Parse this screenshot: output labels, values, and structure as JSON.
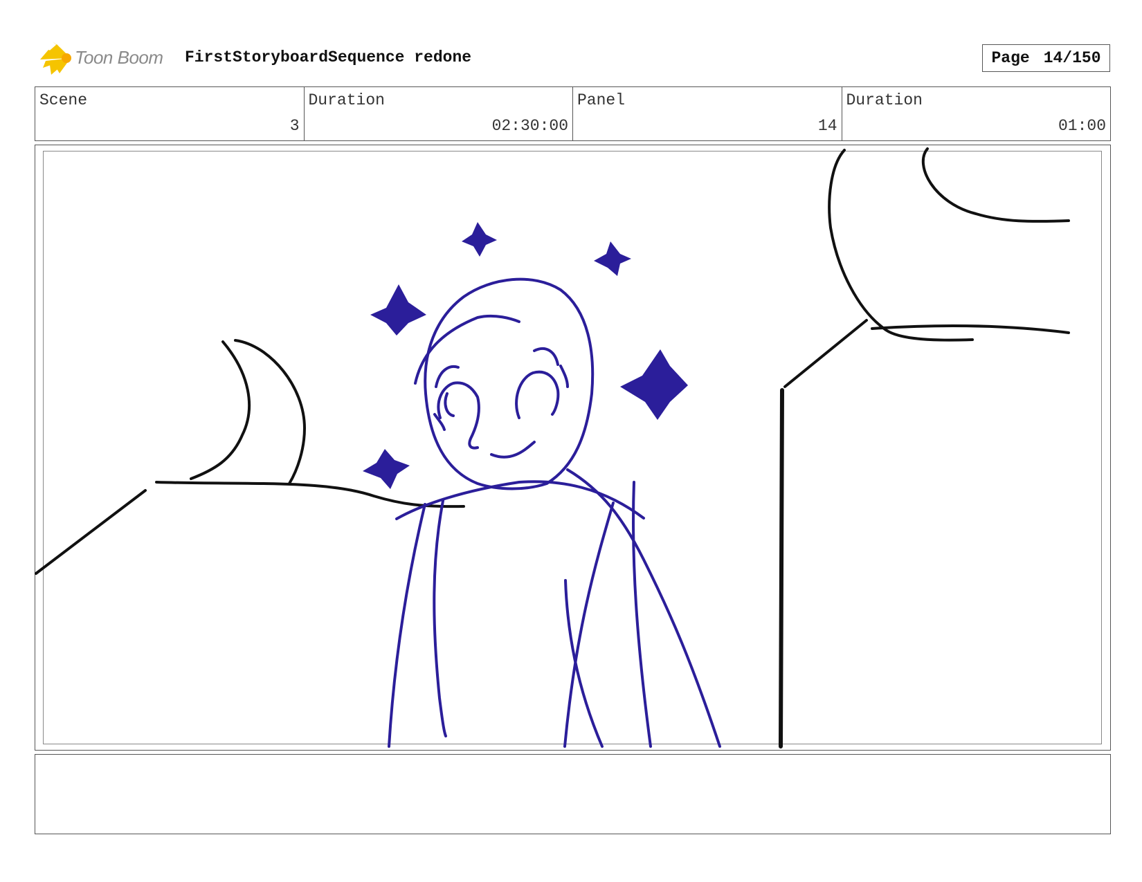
{
  "header": {
    "logo_text": "Toon Boom",
    "project_title": "FirstStoryboardSequence redone",
    "page_label": "Page",
    "page_value": "14/150"
  },
  "info": {
    "scene_label": "Scene",
    "scene_value": "3",
    "scene_duration_label": "Duration",
    "scene_duration_value": "02:30:00",
    "panel_label": "Panel",
    "panel_value": "14",
    "panel_duration_label": "Duration",
    "panel_duration_value": "01:00"
  },
  "colors": {
    "sketch_blue": "#2b1e9a",
    "ink_black": "#111111",
    "logo_yellow": "#f5c400"
  },
  "notes": {
    "text": ""
  }
}
